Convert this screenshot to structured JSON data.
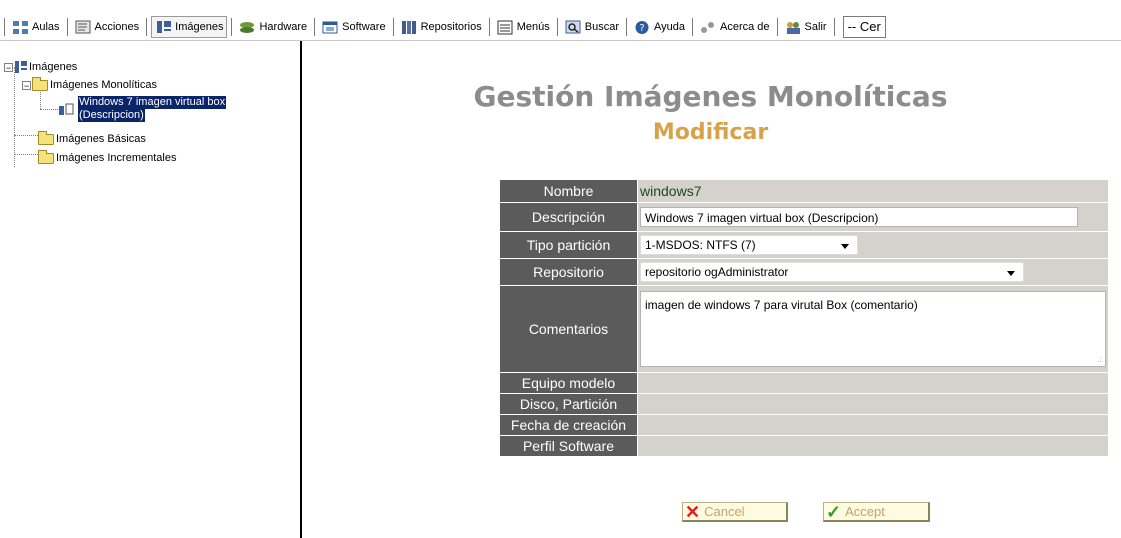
{
  "toolbar": {
    "items": [
      {
        "label": "Aulas",
        "icon": "classroom-icon"
      },
      {
        "label": "Acciones",
        "icon": "actions-icon"
      },
      {
        "label": "Imágenes",
        "icon": "images-icon"
      },
      {
        "label": "Hardware",
        "icon": "hardware-icon"
      },
      {
        "label": "Software",
        "icon": "software-icon"
      },
      {
        "label": "Repositorios",
        "icon": "repository-icon"
      },
      {
        "label": "Menús",
        "icon": "menu-icon"
      },
      {
        "label": "Buscar",
        "icon": "search-icon"
      },
      {
        "label": "Ayuda",
        "icon": "help-icon"
      },
      {
        "label": "Acerca de",
        "icon": "about-icon"
      },
      {
        "label": "Salir",
        "icon": "exit-icon"
      }
    ],
    "select_value": "-- Cer"
  },
  "tree": {
    "root": "Imágenes",
    "monoliticas": "Imágenes Monolíticas",
    "selected_line1": "Windows 7 imagen virtual box",
    "selected_line2": "(Descripcion)",
    "basicas": "Imágenes Básicas",
    "incrementales": "Imágenes Incrementales"
  },
  "heading": {
    "title": "Gestión Imágenes Monolíticas",
    "subtitle": "Modificar"
  },
  "form": {
    "nombre_label": "Nombre",
    "nombre_value": "windows7",
    "descripcion_label": "Descripción",
    "descripcion_value": "Windows 7 imagen virtual box (Descripcion)",
    "tipo_label": "Tipo partición",
    "tipo_value": "1-MSDOS: NTFS (7)",
    "repositorio_label": "Repositorio",
    "repositorio_value": "repositorio ogAdministrator",
    "comentarios_label": "Comentarios",
    "comentarios_value": "imagen de windows 7  para virutal Box (comentario)",
    "equipo_label": "Equipo modelo",
    "disco_label": "Disco, Partición",
    "fecha_label": "Fecha de creación",
    "perfil_label": "Perfil Software"
  },
  "buttons": {
    "cancel": "Cancel",
    "accept": "Accept"
  },
  "colors": {
    "label_bg": "#5b5b5b",
    "value_bg": "#d5d2ce",
    "title": "#8c8c8c",
    "subtitle": "#d9a24a",
    "selection": "#0a246a"
  }
}
